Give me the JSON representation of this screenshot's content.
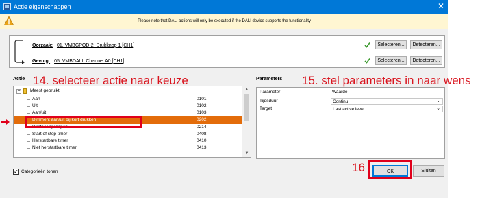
{
  "window": {
    "title": "Actie eigenschappen",
    "close_glyph": "✕"
  },
  "warning": {
    "text": "Please note that DALI actions will only be executed if the DALI device supports the functionality"
  },
  "link": {
    "oorzaak_label": "Oorzaak:",
    "oorzaak_value": "01. VMBGPOD-2, Drukknop 1 [CH1]",
    "gevolg_label": "Gevolg:",
    "gevolg_value": "05. VMBDALI, Channel A0 [CH1]",
    "select_label": "Selecteren...",
    "detect_label": "Detecteren..."
  },
  "action": {
    "label": "Actie",
    "category": "Meest gebruikt",
    "items": [
      {
        "name": "Aan",
        "code": "0101"
      },
      {
        "name": "Uit",
        "code": "0102"
      },
      {
        "name": "Aan/uit",
        "code": "0103"
      },
      {
        "name": "Dimmen; aan/uit bij kort drukken",
        "code": "0202"
      },
      {
        "name": "Dimfeer oproepen",
        "code": "0214"
      },
      {
        "name": "Start of stop timer",
        "code": "0408"
      },
      {
        "name": "Herstartbare timer",
        "code": "0410"
      },
      {
        "name": "Niet herstartbare timer",
        "code": "0413"
      }
    ],
    "selected_index": 3
  },
  "parameters": {
    "label": "Parameters",
    "col_param": "Parameter",
    "col_value": "Waarde",
    "rows": [
      {
        "name": "Tijdsduur",
        "value": "Continu"
      },
      {
        "name": "Target",
        "value": "Last active level"
      }
    ]
  },
  "annotations": {
    "step14": "14. selecteer actie naar keuze",
    "step15": "15. stel parameters in naar wens",
    "step16": "16",
    "color": "#d9141e"
  },
  "footer": {
    "categories_label": "Categorieën tonen",
    "categories_checked": true,
    "ok_label": "OK",
    "close_label": "Sluiten"
  },
  "colors": {
    "titlebar": "#0078d7",
    "selection": "#e36c0a",
    "warning_bg": "#fff6d2"
  }
}
